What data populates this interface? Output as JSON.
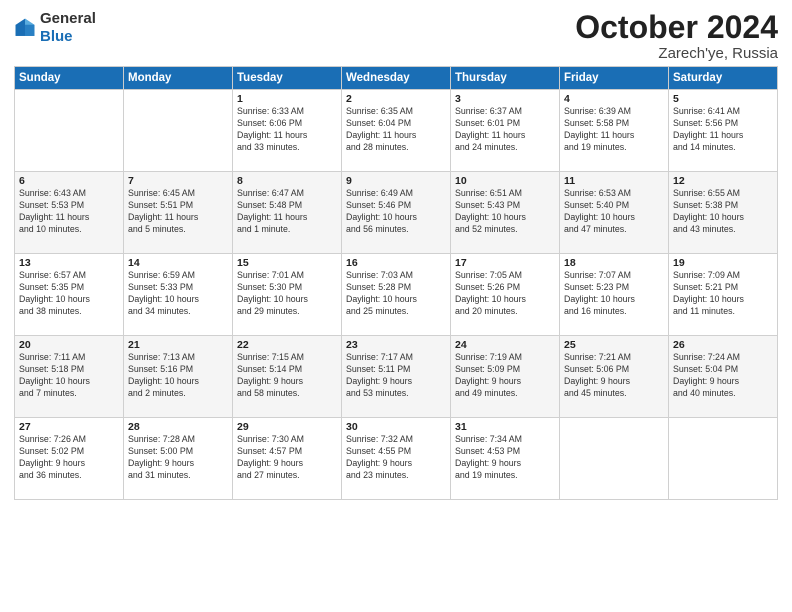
{
  "logo": {
    "general": "General",
    "blue": "Blue"
  },
  "title": "October 2024",
  "location": "Zarech'ye, Russia",
  "days_of_week": [
    "Sunday",
    "Monday",
    "Tuesday",
    "Wednesday",
    "Thursday",
    "Friday",
    "Saturday"
  ],
  "weeks": [
    [
      {
        "day": "",
        "content": ""
      },
      {
        "day": "",
        "content": ""
      },
      {
        "day": "1",
        "content": "Sunrise: 6:33 AM\nSunset: 6:06 PM\nDaylight: 11 hours\nand 33 minutes."
      },
      {
        "day": "2",
        "content": "Sunrise: 6:35 AM\nSunset: 6:04 PM\nDaylight: 11 hours\nand 28 minutes."
      },
      {
        "day": "3",
        "content": "Sunrise: 6:37 AM\nSunset: 6:01 PM\nDaylight: 11 hours\nand 24 minutes."
      },
      {
        "day": "4",
        "content": "Sunrise: 6:39 AM\nSunset: 5:58 PM\nDaylight: 11 hours\nand 19 minutes."
      },
      {
        "day": "5",
        "content": "Sunrise: 6:41 AM\nSunset: 5:56 PM\nDaylight: 11 hours\nand 14 minutes."
      }
    ],
    [
      {
        "day": "6",
        "content": "Sunrise: 6:43 AM\nSunset: 5:53 PM\nDaylight: 11 hours\nand 10 minutes."
      },
      {
        "day": "7",
        "content": "Sunrise: 6:45 AM\nSunset: 5:51 PM\nDaylight: 11 hours\nand 5 minutes."
      },
      {
        "day": "8",
        "content": "Sunrise: 6:47 AM\nSunset: 5:48 PM\nDaylight: 11 hours\nand 1 minute."
      },
      {
        "day": "9",
        "content": "Sunrise: 6:49 AM\nSunset: 5:46 PM\nDaylight: 10 hours\nand 56 minutes."
      },
      {
        "day": "10",
        "content": "Sunrise: 6:51 AM\nSunset: 5:43 PM\nDaylight: 10 hours\nand 52 minutes."
      },
      {
        "day": "11",
        "content": "Sunrise: 6:53 AM\nSunset: 5:40 PM\nDaylight: 10 hours\nand 47 minutes."
      },
      {
        "day": "12",
        "content": "Sunrise: 6:55 AM\nSunset: 5:38 PM\nDaylight: 10 hours\nand 43 minutes."
      }
    ],
    [
      {
        "day": "13",
        "content": "Sunrise: 6:57 AM\nSunset: 5:35 PM\nDaylight: 10 hours\nand 38 minutes."
      },
      {
        "day": "14",
        "content": "Sunrise: 6:59 AM\nSunset: 5:33 PM\nDaylight: 10 hours\nand 34 minutes."
      },
      {
        "day": "15",
        "content": "Sunrise: 7:01 AM\nSunset: 5:30 PM\nDaylight: 10 hours\nand 29 minutes."
      },
      {
        "day": "16",
        "content": "Sunrise: 7:03 AM\nSunset: 5:28 PM\nDaylight: 10 hours\nand 25 minutes."
      },
      {
        "day": "17",
        "content": "Sunrise: 7:05 AM\nSunset: 5:26 PM\nDaylight: 10 hours\nand 20 minutes."
      },
      {
        "day": "18",
        "content": "Sunrise: 7:07 AM\nSunset: 5:23 PM\nDaylight: 10 hours\nand 16 minutes."
      },
      {
        "day": "19",
        "content": "Sunrise: 7:09 AM\nSunset: 5:21 PM\nDaylight: 10 hours\nand 11 minutes."
      }
    ],
    [
      {
        "day": "20",
        "content": "Sunrise: 7:11 AM\nSunset: 5:18 PM\nDaylight: 10 hours\nand 7 minutes."
      },
      {
        "day": "21",
        "content": "Sunrise: 7:13 AM\nSunset: 5:16 PM\nDaylight: 10 hours\nand 2 minutes."
      },
      {
        "day": "22",
        "content": "Sunrise: 7:15 AM\nSunset: 5:14 PM\nDaylight: 9 hours\nand 58 minutes."
      },
      {
        "day": "23",
        "content": "Sunrise: 7:17 AM\nSunset: 5:11 PM\nDaylight: 9 hours\nand 53 minutes."
      },
      {
        "day": "24",
        "content": "Sunrise: 7:19 AM\nSunset: 5:09 PM\nDaylight: 9 hours\nand 49 minutes."
      },
      {
        "day": "25",
        "content": "Sunrise: 7:21 AM\nSunset: 5:06 PM\nDaylight: 9 hours\nand 45 minutes."
      },
      {
        "day": "26",
        "content": "Sunrise: 7:24 AM\nSunset: 5:04 PM\nDaylight: 9 hours\nand 40 minutes."
      }
    ],
    [
      {
        "day": "27",
        "content": "Sunrise: 7:26 AM\nSunset: 5:02 PM\nDaylight: 9 hours\nand 36 minutes."
      },
      {
        "day": "28",
        "content": "Sunrise: 7:28 AM\nSunset: 5:00 PM\nDaylight: 9 hours\nand 31 minutes."
      },
      {
        "day": "29",
        "content": "Sunrise: 7:30 AM\nSunset: 4:57 PM\nDaylight: 9 hours\nand 27 minutes."
      },
      {
        "day": "30",
        "content": "Sunrise: 7:32 AM\nSunset: 4:55 PM\nDaylight: 9 hours\nand 23 minutes."
      },
      {
        "day": "31",
        "content": "Sunrise: 7:34 AM\nSunset: 4:53 PM\nDaylight: 9 hours\nand 19 minutes."
      },
      {
        "day": "",
        "content": ""
      },
      {
        "day": "",
        "content": ""
      }
    ]
  ]
}
